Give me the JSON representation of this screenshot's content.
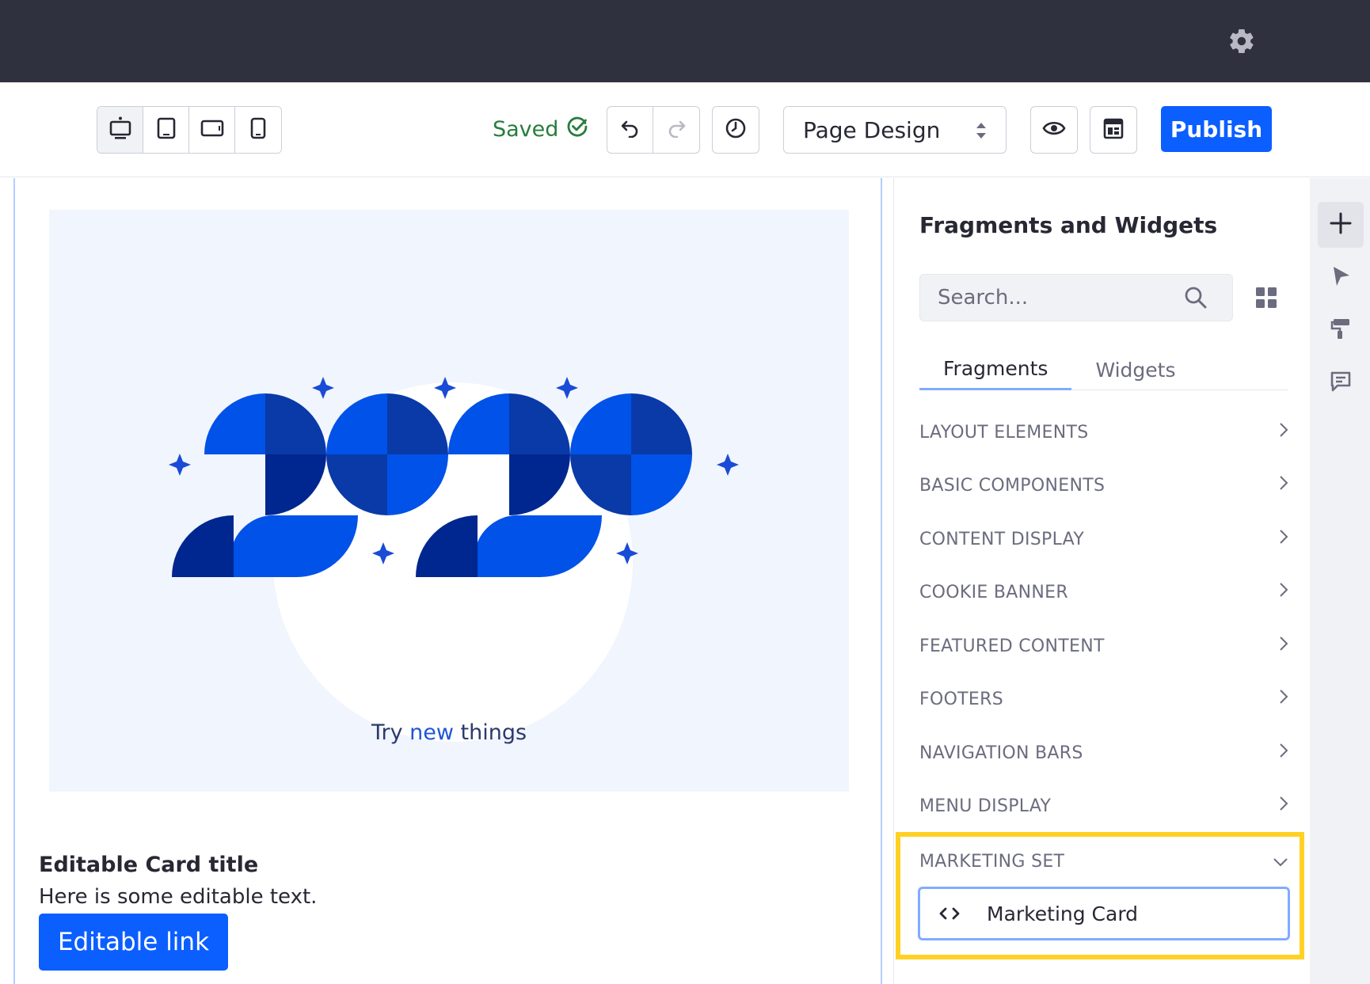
{
  "topbar": {
    "settings_icon": "gear-icon"
  },
  "toolbar": {
    "devices": [
      "desktop-icon",
      "tablet-icon",
      "landscape-icon",
      "phone-icon"
    ],
    "saved_label": "Saved",
    "experience_select": "Page Design",
    "publish_label": "Publish"
  },
  "canvas": {
    "banner": {
      "headline": "2020",
      "tagline_prefix": "Try ",
      "tagline_accent": "new",
      "tagline_suffix": " things"
    },
    "card": {
      "title": "Editable Card title",
      "text": "Here is some editable text.",
      "link_label": "Editable link"
    }
  },
  "panel": {
    "title": "Fragments and Widgets",
    "search_placeholder": "Search...",
    "tabs": [
      {
        "label": "Fragments",
        "active": true
      },
      {
        "label": "Widgets",
        "active": false
      }
    ],
    "categories": [
      "LAYOUT ELEMENTS",
      "BASIC COMPONENTS",
      "CONTENT DISPLAY",
      "COOKIE BANNER",
      "FEATURED CONTENT",
      "FOOTERS",
      "NAVIGATION BARS",
      "MENU DISPLAY"
    ],
    "expanded_category": "MARKETING SET",
    "fragment_item": "Marketing Card"
  },
  "colors": {
    "topbar": "#30313f",
    "primary": "#0b5fff",
    "saved": "#287d3c",
    "highlight": "#ffd124",
    "banner_bg": "#f1f5fd"
  }
}
